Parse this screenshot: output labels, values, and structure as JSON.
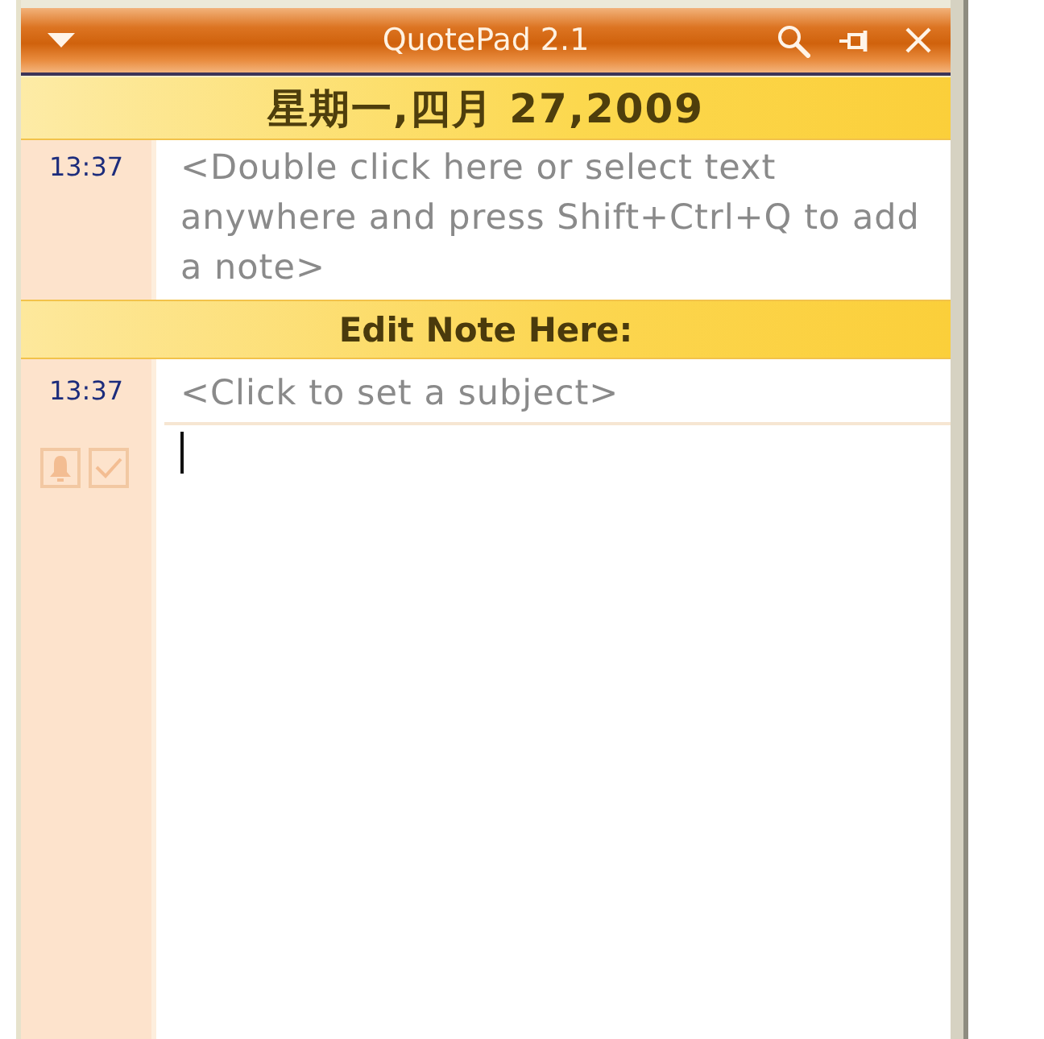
{
  "window": {
    "title": "QuotePad 2.1"
  },
  "date_header": "星期一,四月 27,2009",
  "notes": [
    {
      "time": "13:37",
      "text": "<Double click here or select text anywhere and press Shift+Ctrl+Q to add a note>"
    }
  ],
  "editor": {
    "header": "Edit Note Here:",
    "time": "13:37",
    "subject": {
      "placeholder": "<Click to set a subject>"
    }
  }
}
